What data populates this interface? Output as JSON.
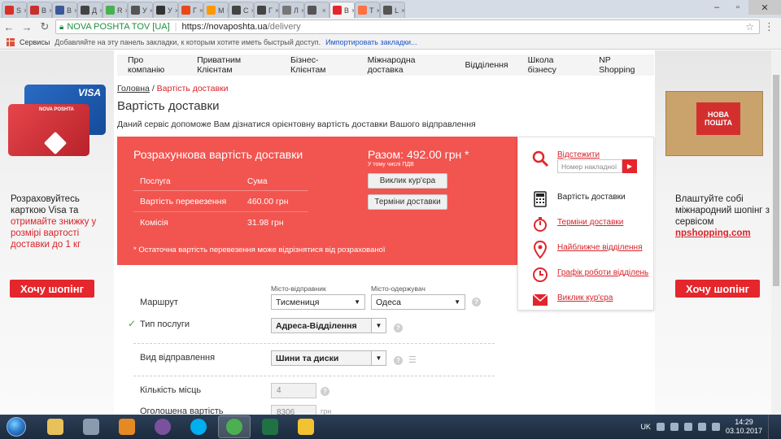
{
  "browser": {
    "tabs": [
      {
        "label": "S",
        "color": "#d93025"
      },
      {
        "label": "В",
        "color": "#c9302c"
      },
      {
        "label": "В",
        "color": "#3b5998"
      },
      {
        "label": "Д",
        "color": "#444444"
      },
      {
        "label": "R",
        "color": "#4caf50"
      },
      {
        "label": "У",
        "color": "#555555"
      },
      {
        "label": "У",
        "color": "#333333"
      },
      {
        "label": "Г",
        "color": "#e64a19"
      },
      {
        "label": "M",
        "color": "#ff9800"
      },
      {
        "label": "С",
        "color": "#444444"
      },
      {
        "label": "Г",
        "color": "#444444"
      },
      {
        "label": "Л",
        "color": "#777777"
      },
      {
        "label": "",
        "color": "#555555"
      },
      {
        "label": "В",
        "color": "#e5262c"
      },
      {
        "label": "Т",
        "color": "#ff7043"
      },
      {
        "label": "L",
        "color": "#555555"
      }
    ],
    "window_controls": {
      "minimize": "–",
      "maximize": "▫",
      "close": "✕"
    },
    "secure_label": "NOVA POSHTA TOV [UA]",
    "url_host": "https://novaposhta.ua",
    "url_path": "/delivery",
    "bookmarks": {
      "apps_label": "Сервисы",
      "hint": "Добавляйте на эту панель закладки, к которым хотите иметь быстрый доступ.",
      "import_link": "Импортировать закладки..."
    }
  },
  "nav": {
    "items": [
      "Про компанію",
      "Приватним Клієнтам",
      "Бізнес-Клієнтам",
      "Міжнародна доставка",
      "Відділення",
      "Школа бізнесу",
      "NP Shopping"
    ]
  },
  "breadcrumb": {
    "home": "Головна",
    "current": "Вартість доставки"
  },
  "page": {
    "title": "Вартість доставки",
    "description": "Даний сервіс допоможе Вам дізнатися орієнтовну вартість доставки Вашого відправлення"
  },
  "result": {
    "title": "Розрахункова вартість доставки",
    "col_service": "Послуга",
    "col_sum": "Сума",
    "rows": [
      {
        "service": "Вартість перевезення",
        "sum": "460.00 грн"
      },
      {
        "service": "Комісія",
        "sum": "31.98 грн"
      }
    ],
    "total": "Разом: 492.00 грн *",
    "vat_note": "У тому числі ПДВ",
    "btn_courier": "Виклик кур'єра",
    "btn_terms": "Терміни доставки",
    "footnote": "* Остаточна вартість перевезення може відрізнятися від розрахованої"
  },
  "form": {
    "route_label": "Маршрут",
    "sender_city_label": "Місто-відправник",
    "sender_city": "Тисмениця",
    "recipient_city_label": "Місто-одержувач",
    "recipient_city": "Одеса",
    "service_type_label": "Тип послуги",
    "service_type": "Адреса-Відділення",
    "shipment_type_label": "Вид відправлення",
    "shipment_type": "Шини та диски",
    "places_label": "Кількість місць",
    "places": "4",
    "declared_label": "Оголошена вартість",
    "declared_value": "8306",
    "declared_unit": "грн"
  },
  "sidepanel": {
    "track_label": "Відстежити",
    "track_placeholder": "Номер накладної",
    "items": [
      {
        "label": "Вартість доставки",
        "icon": "calculator-icon",
        "active": true
      },
      {
        "label": "Терміни доставки",
        "icon": "stopwatch-icon",
        "active": false
      },
      {
        "label": "Найближче відділення",
        "icon": "map-pin-icon",
        "active": false
      },
      {
        "label": "Графік роботи відділень",
        "icon": "clock-icon",
        "active": false
      },
      {
        "label": "Виклик кур'єра",
        "icon": "envelope-icon",
        "active": false
      }
    ]
  },
  "promo_left": {
    "card_brand": "VISA",
    "card_text": "NOVA POSHTA",
    "text_plain": "Розраховуйтесь карткою Visa та ",
    "text_highlight": "отримайте знижку у розмірі вартості доставки до 1 кг",
    "button": "Хочу шопінг"
  },
  "promo_right": {
    "box_text": "НОВА ПОШТА",
    "text_plain": "Влаштуйте собі міжнародний шопінг з сервісом ",
    "text_link": "npshopping.com",
    "button": "Хочу шопінг"
  },
  "taskbar": {
    "apps": [
      {
        "name": "explorer",
        "color": "#e8c15a"
      },
      {
        "name": "network",
        "color": "#8a9bb0"
      },
      {
        "name": "outlook",
        "color": "#e58a22"
      },
      {
        "name": "viber",
        "color": "#7b519d"
      },
      {
        "name": "skype",
        "color": "#00aff0"
      },
      {
        "name": "chrome",
        "color": "#4caf50"
      },
      {
        "name": "excel",
        "color": "#1f7244"
      },
      {
        "name": "1c",
        "color": "#f2c230"
      }
    ],
    "lang": "UK",
    "time": "14:29",
    "date": "03.10.2017"
  },
  "colors": {
    "brand_red": "#e5262c",
    "result_bg": "#f2544f"
  }
}
